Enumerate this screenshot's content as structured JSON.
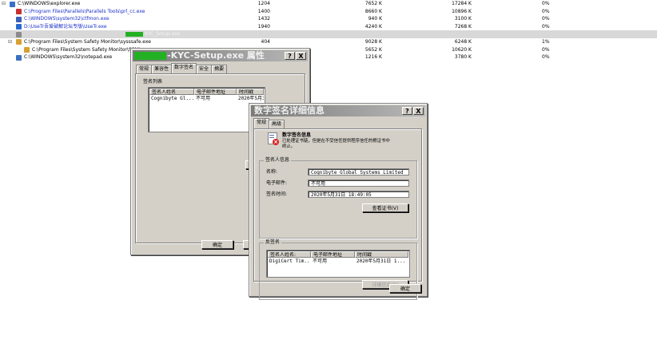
{
  "process_list": [
    {
      "path": "C:\\WINDOWS\\explorer.exe",
      "pid": "1204",
      "private_bytes": "7652 K",
      "working_set": "17284 K",
      "cpu": "0%"
    },
    {
      "path": "C:\\Program Files\\Parallels\\Parallels Tools\\prl_cc.exe",
      "pid": "1400",
      "private_bytes": "8660 K",
      "working_set": "10896 K",
      "cpu": "0%"
    },
    {
      "path": "C:\\WINDOWS\\system32\\ctfmon.exe",
      "pid": "1432",
      "private_bytes": "940 K",
      "working_set": "3100 K",
      "cpu": "0%"
    },
    {
      "path": "D:\\UseTr吾爱破解论坛专版\\UseTr.exe",
      "pid": "1940",
      "private_bytes": "4240 K",
      "working_set": "7268 K",
      "cpu": "0%"
    },
    {
      "path": "",
      "pid": "",
      "private_bytes": "",
      "working_set": "",
      "cpu": "",
      "selected_suffix": "KYC_Setup.exe"
    },
    {
      "path": "C:\\Program Files\\System Safety Monitor\\sysssafe.exe",
      "pid": "404",
      "private_bytes": "9028 K",
      "working_set": "6248 K",
      "cpu": "1%"
    },
    {
      "path": "C:\\Program Files\\System Safety Monitor\\SSMI",
      "pid": "",
      "private_bytes": "5652 K",
      "working_set": "10620 K",
      "cpu": "0%"
    },
    {
      "path": "C:\\WINDOWS\\system32\\notepad.exe",
      "pid": "",
      "private_bytes": "1216 K",
      "working_set": "3780 K",
      "cpu": "0%"
    }
  ],
  "props_dialog": {
    "title": "-KYC-Setup.exe 属性",
    "help_btn": "?",
    "close_btn": "X",
    "tabs": [
      "常规",
      "兼容性",
      "数字签名",
      "安全",
      "摘要"
    ],
    "active_tab": 2,
    "sig_list_label": "签名列表",
    "columns": [
      "签名人姓名",
      "电子邮件地址",
      "时间戳"
    ],
    "row": [
      "Cognibyte Gl...",
      "不可用",
      "2020年5月31日 1..."
    ],
    "ok_btn": "确定"
  },
  "details_dialog": {
    "title": "数字签名详细信息",
    "help_btn": "?",
    "close_btn": "X",
    "tabs": [
      "常规",
      "高级"
    ],
    "active_tab": 0,
    "info_title": "数字签名信息",
    "info_text_1": "已处理证书链，但是在不受信任提供程序信任的根证书中",
    "info_text_2": "终止。",
    "signer_group": "签名人信息",
    "name_label": "名称:",
    "name_value": "Cognibyte Global Systems Limited",
    "email_label": "电子邮件:",
    "email_value": "不可用",
    "time_label": "签名时间:",
    "time_value": "2020年5月31日 18:49:05",
    "view_cert_btn": "查看证书(V)",
    "countersig_group": "反签名",
    "cs_columns": [
      "签名人姓名:",
      "电子邮件地址",
      "时间戳"
    ],
    "cs_row": [
      "DigiCert Tim...",
      "不可用",
      "2020年5月31日 1..."
    ],
    "cs_details_btn": "详细信息(D)",
    "ok_btn": "确定"
  },
  "colors": {
    "accent_green": "#23b023",
    "blue_text": "#1a30c8",
    "dialog_bg": "#d4d0c8"
  }
}
